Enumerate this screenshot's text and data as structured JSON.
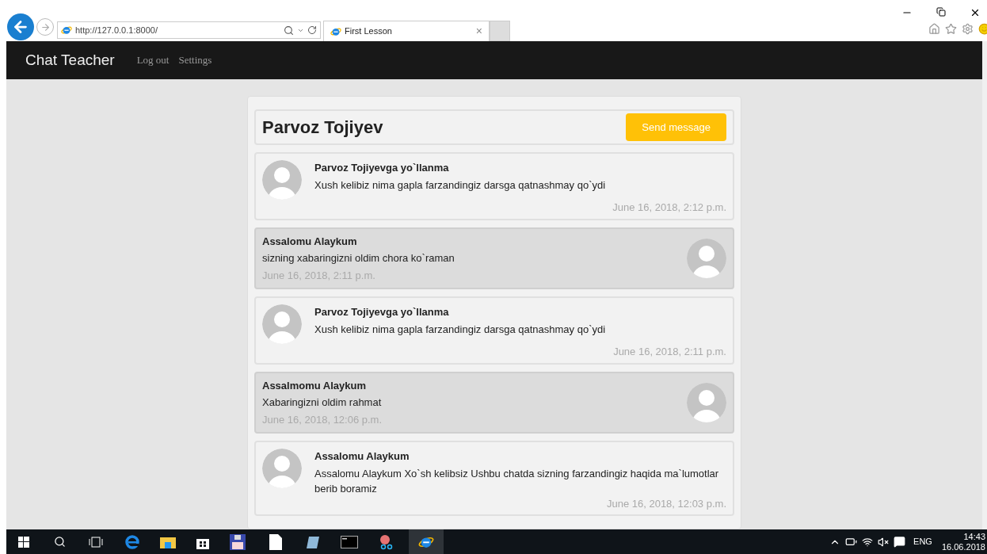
{
  "browser": {
    "address": "http://127.0.0.1:8000/",
    "tab_title": "First Lesson",
    "close_tab": "×"
  },
  "navbar": {
    "brand": "Chat Teacher",
    "links": [
      "Log out",
      "Settings"
    ]
  },
  "chat": {
    "title": "Parvoz Tojiyev",
    "send_button": "Send message",
    "messages": [
      {
        "kind": "received",
        "title": "Parvoz Tojiyevga yo`llanma",
        "text": "Xush kelibiz nima gapla farzandingiz darsga qatnashmay qo`ydi",
        "date": "June 16, 2018, 2:12 p.m."
      },
      {
        "kind": "sent",
        "title": "Assalomu Alaykum",
        "text": "sizning xabaringizni oldim chora ko`raman",
        "date": "June 16, 2018, 2:11 p.m."
      },
      {
        "kind": "received",
        "title": "Parvoz Tojiyevga yo`llanma",
        "text": "Xush kelibiz nima gapla farzandingiz darsga qatnashmay qo`ydi",
        "date": "June 16, 2018, 2:11 p.m."
      },
      {
        "kind": "sent",
        "title": "Assalmomu Alaykum",
        "text": "Xabaringizni oldim rahmat",
        "date": "June 16, 2018, 12:06 p.m."
      },
      {
        "kind": "received",
        "title": "Assalomu Alaykum",
        "text": "Assalomu Alaykum Xo`sh kelibsiz Ushbu chatda sizning farzandingiz haqida ma`lumotlar berib boramiz",
        "date": "June 16, 2018, 12:03 p.m."
      }
    ]
  },
  "taskbar": {
    "language": "ENG",
    "time": "14:43",
    "date": "16.06.2018"
  }
}
